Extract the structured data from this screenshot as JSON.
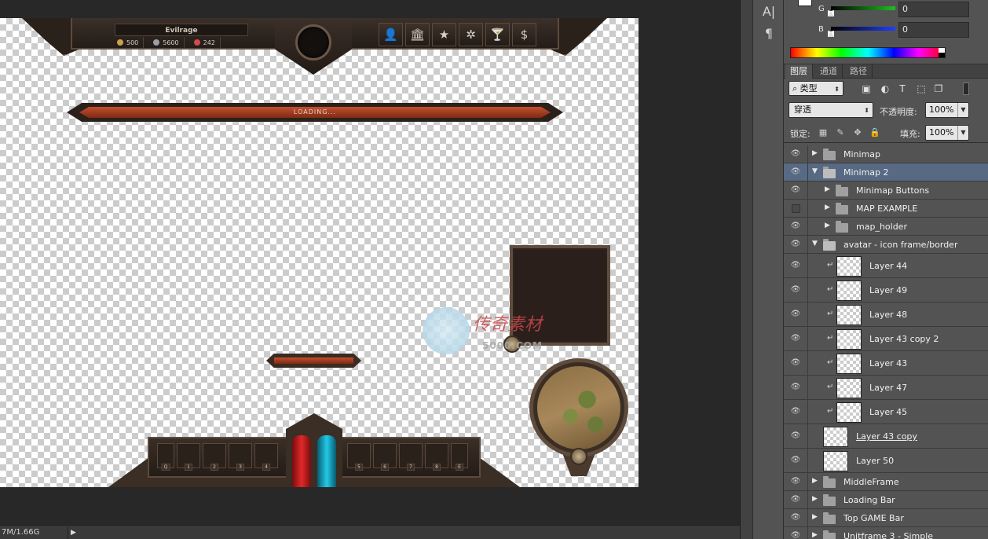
{
  "canvas": {
    "top_bar": {
      "player_name": "Evilrage",
      "currencies": [
        {
          "icon": "coin-icon",
          "value": "500",
          "color": "#c9a24a"
        },
        {
          "icon": "swords-icon",
          "value": "5600",
          "color": "#9aa0a6"
        },
        {
          "icon": "gem-icon",
          "value": "242",
          "color": "#d04a4a"
        }
      ],
      "buttons": [
        {
          "name": "character-icon",
          "glyph": "👤"
        },
        {
          "name": "guild-icon",
          "glyph": "🏛"
        },
        {
          "name": "star-icon",
          "glyph": "★"
        },
        {
          "name": "settings-icon",
          "glyph": "✲"
        },
        {
          "name": "trophy-icon",
          "glyph": "🍸"
        },
        {
          "name": "shop-icon",
          "glyph": "$"
        }
      ]
    },
    "loading_bar": {
      "text": "LOADING..."
    },
    "action_bar": {
      "left_slots": [
        "Q",
        "1",
        "2",
        "3",
        "4"
      ],
      "right_slots": [
        "5",
        "6",
        "7",
        "8",
        "E"
      ]
    },
    "watermark": {
      "cn": "传奇素材",
      "url": "5000.COM"
    }
  },
  "status": {
    "doc_size": "7M/1.66G"
  },
  "tools": [
    {
      "name": "character-tool-icon",
      "glyph": "A|"
    },
    {
      "name": "paragraph-tool-icon",
      "glyph": "¶"
    }
  ],
  "color_panel": {
    "sliders": [
      {
        "label": "G",
        "value": "0",
        "color": "#1fbf1f"
      },
      {
        "label": "B",
        "value": "0",
        "color": "#1f3fff"
      }
    ]
  },
  "layers_panel": {
    "tabs": [
      "图层",
      "通道",
      "路径"
    ],
    "active_tab": 0,
    "filter_type": "类型",
    "blend_mode": "穿透",
    "opacity_label": "不透明度:",
    "opacity_value": "100%",
    "lock_label": "锁定:",
    "fill_label": "填充:",
    "fill_value": "100%",
    "layers": [
      {
        "name": "Minimap",
        "type": "folder",
        "level": 0,
        "expanded": false,
        "visible": true,
        "selected": false
      },
      {
        "name": "Minimap 2",
        "type": "folder",
        "level": 0,
        "expanded": true,
        "visible": true,
        "selected": true
      },
      {
        "name": "Minimap Buttons",
        "type": "folder",
        "level": 1,
        "expanded": false,
        "visible": true,
        "selected": false
      },
      {
        "name": "MAP EXAMPLE",
        "type": "folder",
        "level": 1,
        "expanded": false,
        "visible": false,
        "selected": false
      },
      {
        "name": "map_holder",
        "type": "folder",
        "level": 1,
        "expanded": false,
        "visible": true,
        "selected": false
      },
      {
        "name": "avatar - icon frame/border",
        "type": "folder",
        "level": 0,
        "expanded": true,
        "visible": true,
        "selected": false
      },
      {
        "name": "Layer 44",
        "type": "layer",
        "clipped": true,
        "visible": true,
        "selected": false
      },
      {
        "name": "Layer 49",
        "type": "layer",
        "clipped": true,
        "visible": true,
        "selected": false
      },
      {
        "name": "Layer 48",
        "type": "layer",
        "clipped": true,
        "visible": true,
        "selected": false
      },
      {
        "name": "Layer 43 copy 2",
        "type": "layer",
        "clipped": true,
        "visible": true,
        "selected": false
      },
      {
        "name": "Layer 43",
        "type": "layer",
        "clipped": true,
        "visible": true,
        "selected": false
      },
      {
        "name": "Layer 47",
        "type": "layer",
        "clipped": true,
        "visible": true,
        "selected": false
      },
      {
        "name": "Layer 45",
        "type": "layer",
        "clipped": true,
        "visible": true,
        "selected": false
      },
      {
        "name": "Layer 43 copy",
        "type": "layer",
        "clipped": false,
        "base": true,
        "visible": true,
        "selected": false
      },
      {
        "name": "Layer 50",
        "type": "layer",
        "clipped": false,
        "visible": true,
        "selected": false
      },
      {
        "name": "MiddleFrame",
        "type": "folder",
        "level": 0,
        "expanded": false,
        "visible": true,
        "selected": false
      },
      {
        "name": "Loading Bar",
        "type": "folder",
        "level": 0,
        "expanded": false,
        "visible": true,
        "selected": false
      },
      {
        "name": "Top GAME Bar",
        "type": "folder",
        "level": 0,
        "expanded": false,
        "visible": true,
        "selected": false
      },
      {
        "name": "Unitframe 3 - Simple",
        "type": "folder",
        "level": 0,
        "expanded": false,
        "visible": true,
        "selected": false
      }
    ]
  }
}
